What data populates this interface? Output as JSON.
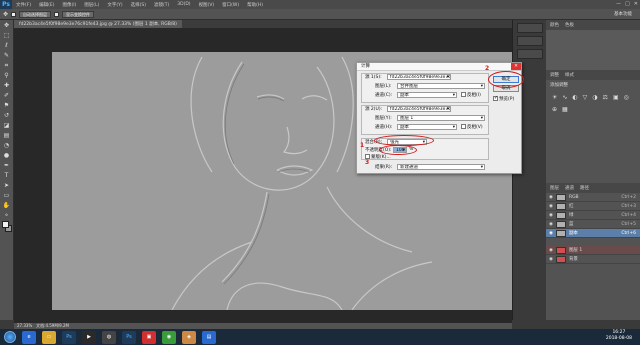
{
  "app": {
    "logo": "Ps"
  },
  "menu": [
    "文件(F)",
    "编辑(E)",
    "图像(I)",
    "图层(L)",
    "文字(Y)",
    "选择(S)",
    "滤镜(T)",
    "3D(D)",
    "视图(V)",
    "窗口(W)",
    "帮助(H)"
  ],
  "options": {
    "buttons": [
      "自动选择图层",
      "显示变换控件"
    ],
    "right_label": "基本功能"
  },
  "document": {
    "tab_title": "fd22b3ac4e5f0f98e9e3e76c91fe43.jpg @ 27.33% (图层 1 副本, RGB/8)"
  },
  "status": {
    "zoom": "27.33%",
    "doc": "文档:4.59M/9.2M"
  },
  "dialog": {
    "title": "计算",
    "source1_label": "源 1(S):",
    "source1_value": "fd22b3ac4e5f0f98e9e3e76c91fe43...",
    "source1_layer_label": "图层(L):",
    "source1_layer_value": "合并图层",
    "source1_channel_label": "通道(C):",
    "source1_channel_value": "副本",
    "invert1": "反相(I)",
    "source2_label": "源 2(U):",
    "source2_value": "fd22b3ac4e5f0f98e9e3e76c91fe43...",
    "source2_layer_label": "图层(Y):",
    "source2_layer_value": "图层 1",
    "source2_channel_label": "通道(H):",
    "source2_channel_value": "副本",
    "invert2": "反相(V)",
    "blend_label": "混合(B):",
    "blend_value": "强光",
    "opacity_label": "不透明度(O):",
    "opacity_value": "100",
    "opacity_unit": "%",
    "mask_label": "蒙版(K)...",
    "result_label": "结果(R):",
    "result_value": "新建通道",
    "ok": "确定",
    "cancel": "取消",
    "preview": "预览(P)"
  },
  "annotations": [
    "1",
    "2",
    "3"
  ],
  "panels": {
    "tabs": [
      "颜色",
      "色板"
    ],
    "adjust_tabs": [
      "调整",
      "样式"
    ],
    "add_adjust": "添加调整",
    "layers_tabs": [
      "图层",
      "通道",
      "路径"
    ],
    "channels": [
      {
        "name": "RGB",
        "shortcut": "Ctrl+2"
      },
      {
        "name": "红",
        "shortcut": "Ctrl+3"
      },
      {
        "name": "绿",
        "shortcut": "Ctrl+4"
      },
      {
        "name": "蓝",
        "shortcut": "Ctrl+5"
      },
      {
        "name": "副本",
        "shortcut": "Ctrl+6"
      }
    ],
    "layers": [
      {
        "name": "图层 1"
      },
      {
        "name": "背景"
      }
    ]
  },
  "taskbar": {
    "time": "16:27",
    "date": "2018-08-08"
  },
  "colors": {
    "accent": "#d21a1a",
    "selection": "#5b7fa8"
  }
}
